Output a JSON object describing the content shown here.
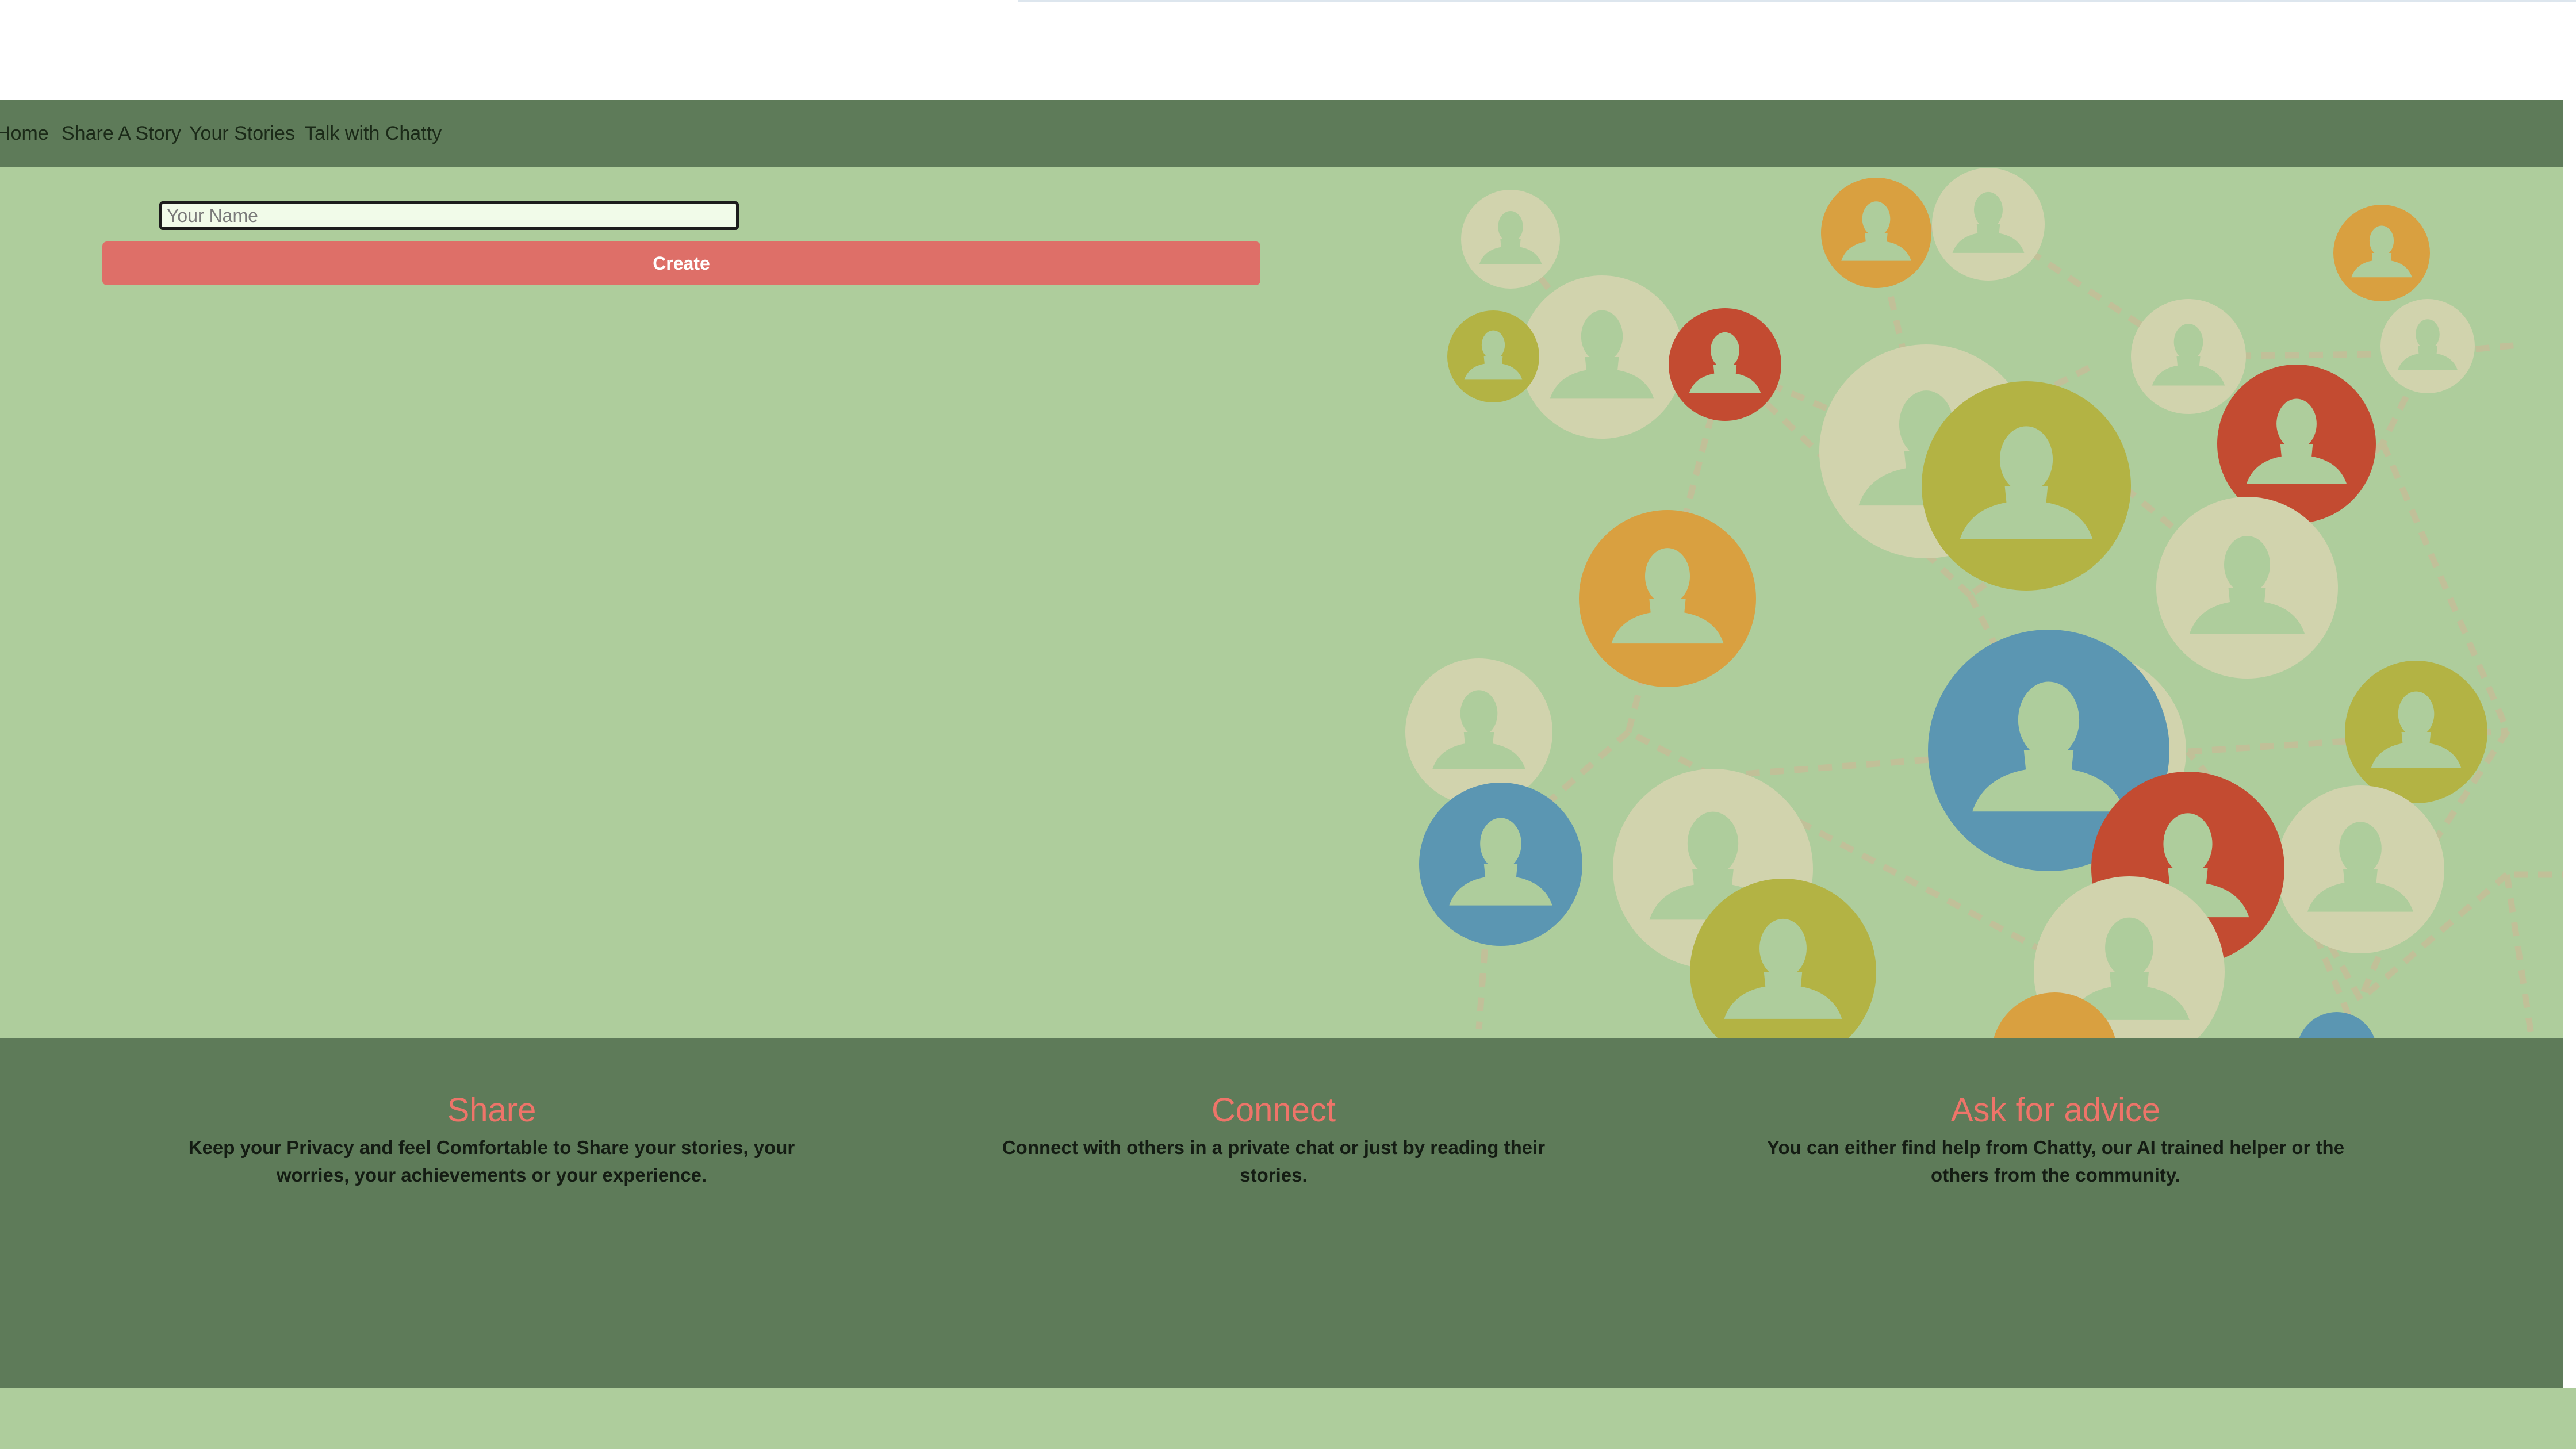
{
  "nav": {
    "items": [
      {
        "label": "Home"
      },
      {
        "label": "Share A Story"
      },
      {
        "label": "Your Stories"
      },
      {
        "label": "Talk with Chatty"
      }
    ]
  },
  "form": {
    "name_placeholder": "Your Name",
    "name_value": "",
    "create_label": "Create"
  },
  "hero": {
    "image_icon": "people-network-icon"
  },
  "features": [
    {
      "title": "Share",
      "text": "Keep your Privacy and feel Comfortable to Share your stories, your worries, your achievements or your experience."
    },
    {
      "title": "Connect",
      "text": "Connect with others in a private chat or just by reading their stories."
    },
    {
      "title": "Ask for advice",
      "text": "You can either find help from Chatty, our AI trained helper or the others from the community."
    }
  ],
  "colors": {
    "background": "#aecd9c",
    "navbar": "#5e7b59",
    "accent": "#de6f68",
    "feature_title": "#ee7469"
  }
}
